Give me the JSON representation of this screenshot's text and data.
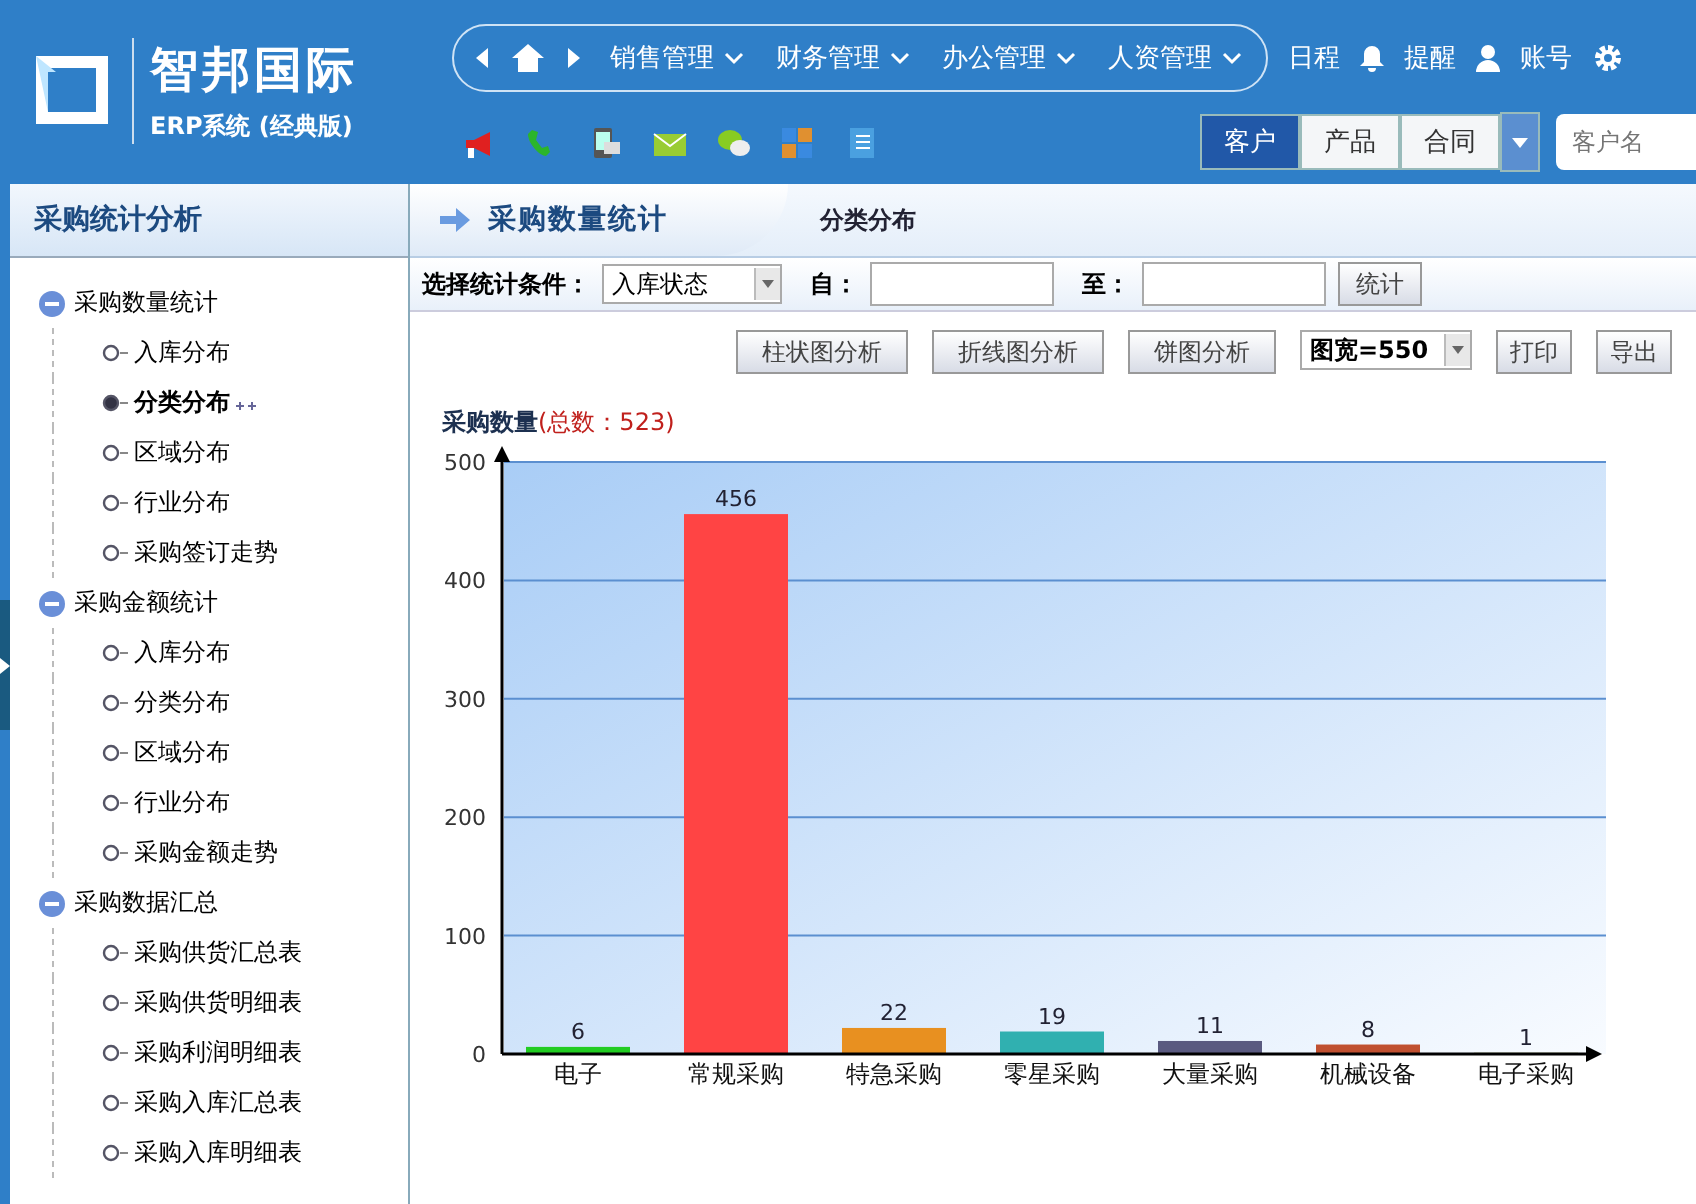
{
  "header": {
    "brand": "智邦国际",
    "edition": "ERP系统 (经典版)",
    "nav_menus": [
      "销售管理",
      "财务管理",
      "办公管理",
      "人资管理"
    ],
    "top_links": [
      "日程",
      "提醒",
      "账号"
    ],
    "quick_tabs": [
      {
        "label": "客户",
        "selected": true
      },
      {
        "label": "产品",
        "selected": false
      },
      {
        "label": "合同",
        "selected": false
      }
    ],
    "search": {
      "placeholder": "客户名"
    }
  },
  "sidebar": {
    "title": "采购统计分析",
    "tree": [
      {
        "label": "采购数量统计",
        "expanded": true,
        "children": [
          {
            "label": "入库分布",
            "selected": false
          },
          {
            "label": "分类分布",
            "selected": true
          },
          {
            "label": "区域分布",
            "selected": false
          },
          {
            "label": "行业分布",
            "selected": false
          },
          {
            "label": "采购签订走势",
            "selected": false
          }
        ]
      },
      {
        "label": "采购金额统计",
        "expanded": true,
        "children": [
          {
            "label": "入库分布",
            "selected": false
          },
          {
            "label": "分类分布",
            "selected": false
          },
          {
            "label": "区域分布",
            "selected": false
          },
          {
            "label": "行业分布",
            "selected": false
          },
          {
            "label": "采购金额走势",
            "selected": false
          }
        ]
      },
      {
        "label": "采购数据汇总",
        "expanded": true,
        "children": [
          {
            "label": "采购供货汇总表",
            "selected": false
          },
          {
            "label": "采购供货明细表",
            "selected": false
          },
          {
            "label": "采购利润明细表",
            "selected": false
          },
          {
            "label": "采购入库汇总表",
            "selected": false
          },
          {
            "label": "采购入库明细表",
            "selected": false
          }
        ]
      }
    ]
  },
  "content": {
    "title": "采购数量统计",
    "tab": "分类分布",
    "filter": {
      "label": "选择统计条件：",
      "condition": "入库状态",
      "from_label": "自：",
      "to_label": "至：",
      "button": "统计"
    },
    "toolbar": {
      "buttons": [
        "柱状图分析",
        "折线图分析",
        "饼图分析"
      ],
      "width_select": "图宽=550",
      "actions": [
        "打印",
        "导出"
      ]
    },
    "chart_data": {
      "type": "bar",
      "annotations": [
        "(总数：523)"
      ],
      "grid": true,
      "categories": [
        "电子",
        "常规采购",
        "特急采购",
        "零星采购",
        "大量采购",
        "机械设备",
        "电子采购"
      ],
      "series": [
        {
          "name": "采购数量",
          "values": [
            6,
            456,
            22,
            19,
            11,
            8,
            1
          ]
        }
      ],
      "ylim": [
        0,
        500
      ],
      "yticks": [
        0,
        100,
        200,
        300,
        400,
        500
      ],
      "data_labels": true
    }
  }
}
